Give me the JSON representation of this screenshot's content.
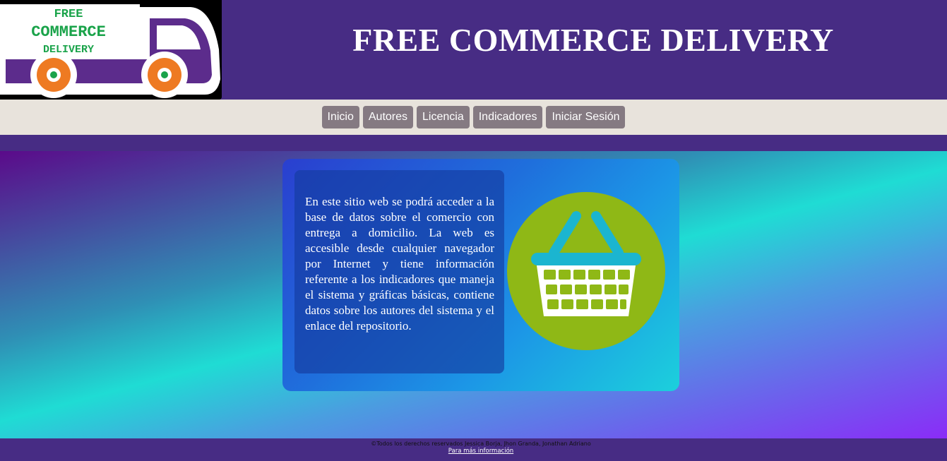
{
  "header": {
    "logo_text": [
      "FREE",
      "COMMERCE",
      "DELIVERY"
    ],
    "title": "FREE COMMERCE DELIVERY"
  },
  "nav": {
    "items": [
      {
        "label": "Inicio"
      },
      {
        "label": "Autores"
      },
      {
        "label": "Licencia"
      },
      {
        "label": "Indicadores"
      },
      {
        "label": "Iniciar Sesión"
      }
    ]
  },
  "main": {
    "intro": "En este sitio web se podrá acceder a la base de datos sobre el comercio con entrega a domicilio. La web es accesible desde cualquier navegador por Internet y tiene información referente a los indicadores que maneja el sistema y gráficas básicas, contiene datos sobre los autores del sistema y el enlace del repositorio.",
    "image_icon": "shopping-basket-icon"
  },
  "footer": {
    "copyright": "©Todos los derechos reservados Jessica Borja, Jhon Granda, Jonathan Adriano",
    "link": "Para más información"
  },
  "colors": {
    "header_bg": "#472c84",
    "nav_bg": "#e8e3dc",
    "nav_button": "#857a82",
    "logo_green": "#1aa34a",
    "truck_purple": "#5c2c8c",
    "wheel_orange": "#ee7a22",
    "basket_circle": "#8fb816",
    "basket_handle": "#1bb5d0"
  }
}
